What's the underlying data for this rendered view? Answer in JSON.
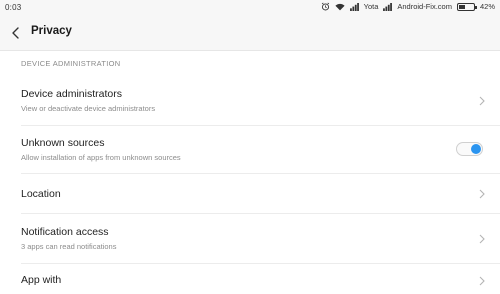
{
  "status": {
    "time": "0:03",
    "carrier": "Yota",
    "site": "Android-Fix.com",
    "battery": "42%",
    "battery_level": 0.42
  },
  "header": {
    "back_icon": "chevron-left-icon",
    "title": "Privacy"
  },
  "section": {
    "label": "DEVICE ADMINISTRATION"
  },
  "items": [
    {
      "title": "Device administrators",
      "subtitle": "View or deactivate device administrators",
      "control": "chevron-right-icon"
    },
    {
      "title": "Unknown sources",
      "subtitle": "Allow installation of apps from unknown sources",
      "control": "toggle",
      "toggle_on": true,
      "accent": "#2b95f0"
    },
    {
      "title": "Location",
      "subtitle": "",
      "control": "chevron-right-icon"
    },
    {
      "title": "Notification access",
      "subtitle": "3 apps can read notifications",
      "control": "chevron-right-icon"
    },
    {
      "title": "App with",
      "subtitle": "",
      "control": "chevron-right-icon"
    }
  ]
}
